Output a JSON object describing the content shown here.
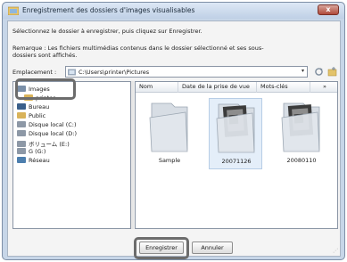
{
  "window": {
    "title": "Enregistrement des dossiers d'images visualisables",
    "close_label": "x"
  },
  "instruction": "Sélectionnez le dossier à enregistrer, puis cliquez sur Enregistrer.",
  "remark": "Remarque : Les fichiers multimédias contenus dans le dossier sélectionné et ses sous-dossiers sont affichés.",
  "location": {
    "label": "Emplacement :",
    "path": "C:\\Users\\printer\\Pictures",
    "dropdown_arrow": "▾"
  },
  "tree": {
    "items": [
      {
        "label": "Images",
        "icon": "pictures-icon",
        "color": "#7a8fa8"
      },
      {
        "label": "printer",
        "icon": "user-folder-icon",
        "color": "#d9b35a"
      },
      {
        "label": "Bureau",
        "icon": "desktop-icon",
        "color": "#3a5f8a"
      },
      {
        "label": "Public",
        "icon": "public-folder-icon",
        "color": "#d9b35a"
      },
      {
        "label": "Disque local (C:)",
        "icon": "drive-icon",
        "color": "#8d98a6"
      },
      {
        "label": "Disque local (D:)",
        "icon": "drive-icon",
        "color": "#8d98a6"
      },
      {
        "label": "ボリューム (E:)",
        "icon": "drive-icon",
        "color": "#8d98a6"
      },
      {
        "label": "G (G:)",
        "icon": "drive-icon",
        "color": "#8d98a6"
      },
      {
        "label": "Réseau",
        "icon": "network-icon",
        "color": "#4d7fae"
      }
    ]
  },
  "files": {
    "columns": [
      "Nom",
      "Date de la prise de vue",
      "Mots-clés",
      "»"
    ],
    "folders": [
      {
        "name": "Sample",
        "selected": false
      },
      {
        "name": "20071126",
        "selected": true
      },
      {
        "name": "20080110",
        "selected": false
      }
    ]
  },
  "buttons": {
    "save": "Enregistrer",
    "cancel": "Annuler"
  },
  "colors": {
    "frame": "#c7d6e8",
    "highlight": "#6c6c6c",
    "selection": "#e4eef9"
  }
}
